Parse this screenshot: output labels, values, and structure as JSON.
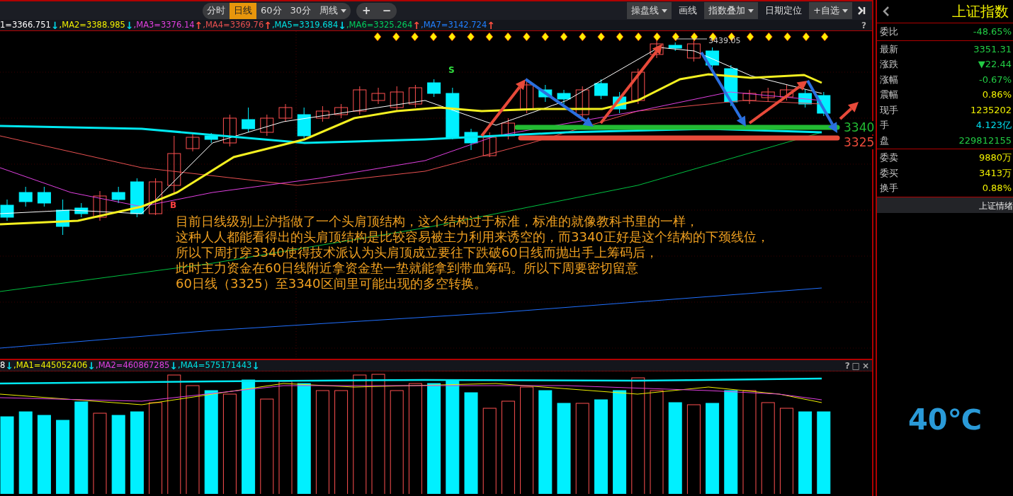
{
  "toolbar": {
    "periods": [
      {
        "label": "分时",
        "selected": false,
        "dropdown": false
      },
      {
        "label": "日线",
        "selected": true,
        "dropdown": false
      },
      {
        "label": "60分",
        "selected": false,
        "dropdown": false
      },
      {
        "label": "30分",
        "selected": false,
        "dropdown": false
      },
      {
        "label": "周线",
        "selected": false,
        "dropdown": true
      }
    ],
    "zoom_buttons": [
      "+",
      "−"
    ],
    "tools": [
      {
        "label": "操盘线",
        "dropdown": true
      },
      {
        "label": "画线",
        "dropdown": false
      },
      {
        "label": "指数叠加",
        "dropdown": true
      },
      {
        "label": "日期定位",
        "dropdown": false
      },
      {
        "label": "+自选",
        "dropdown": true
      }
    ]
  },
  "ma_legend": {
    "items": [
      {
        "kind": "value",
        "label": "1=3366.751",
        "color": "#ffffff"
      },
      {
        "kind": "arrow",
        "label": "↓",
        "color": "#00d8e8"
      },
      {
        "kind": "value",
        "label": ",MA2=3388.985",
        "color": "#f0f000"
      },
      {
        "kind": "arrow",
        "label": "↓",
        "color": "#00d8e8"
      },
      {
        "kind": "value",
        "label": ",MA3=3376.14",
        "color": "#e040e0"
      },
      {
        "kind": "arrow",
        "label": "↑",
        "color": "#ff5040"
      },
      {
        "kind": "value",
        "label": ",MA4=3369.76",
        "color": "#e85050"
      },
      {
        "kind": "arrow",
        "label": "↑",
        "color": "#ff5040"
      },
      {
        "kind": "value",
        "label": ",MA5=3319.684",
        "color": "#00e0e0"
      },
      {
        "kind": "arrow",
        "label": "↓",
        "color": "#00d8e8"
      },
      {
        "kind": "value",
        "label": ",MA6=3325.264",
        "color": "#00d060"
      },
      {
        "kind": "arrow",
        "label": "↑",
        "color": "#ff5040"
      },
      {
        "kind": "value",
        "label": ",MA7=3142.724",
        "color": "#2080ff"
      },
      {
        "kind": "arrow",
        "label": "↑",
        "color": "#ff5040"
      }
    ],
    "help": "?"
  },
  "chart": {
    "high_label": "3439.05",
    "signals": [
      {
        "label": "S",
        "kind": "sell"
      },
      {
        "label": "B",
        "kind": "buy"
      }
    ],
    "price_levels": [
      {
        "label": "3340",
        "color": "#22bb33"
      },
      {
        "label": "3325",
        "color": "#e84a3a"
      }
    ],
    "annotation_lines": [
      "目前日线级别上沪指做了一个头肩顶结构，这个结构过于标准，标准的就像教科书里的一样，",
      "这种人人都能看得出的头肩顶结构是比较容易被主力利用来诱空的，而3340正好是这个结构的下颈线位，",
      "所以下周打穿3340使得技术派认为头肩顶成立要往下跌破60日线而抛出手上筹码后，",
      "此时主力资金在60日线附近拿资金垫一垫就能拿到带血筹码。所以下周要密切留意",
      "60日线（3325）至3340区间里可能出现的多空转换。"
    ]
  },
  "volume_legend": {
    "items": [
      {
        "kind": "value",
        "label": "8",
        "color": "#ffffff"
      },
      {
        "kind": "arrow",
        "label": "↓",
        "color": "#00d8e8"
      },
      {
        "kind": "value",
        "label": ",MA1=445052406",
        "color": "#f0f000"
      },
      {
        "kind": "arrow",
        "label": "↓",
        "color": "#00d8e8"
      },
      {
        "kind": "value",
        "label": ",MA2=460867285",
        "color": "#e040e0"
      },
      {
        "kind": "arrow",
        "label": "↓",
        "color": "#00d8e8"
      },
      {
        "kind": "value",
        "label": ",MA4=575171443",
        "color": "#00e0e0"
      },
      {
        "kind": "arrow",
        "label": "↓",
        "color": "#00d8e8"
      }
    ],
    "controls": [
      "?",
      "□",
      "×"
    ]
  },
  "quote": {
    "title": "上证指数",
    "sections": [
      {
        "rows": [
          {
            "label": "委比",
            "value": "-48.65%",
            "color": "#22cc44"
          }
        ]
      },
      {
        "rows": [
          {
            "label": "最新",
            "value": "3351.31",
            "color": "#22cc44"
          },
          {
            "label": "涨跌",
            "value": "▼22.44",
            "color": "#22cc44"
          },
          {
            "label": "涨幅",
            "value": "-0.67%",
            "color": "#22cc44"
          },
          {
            "label": "震幅",
            "value": "0.86%",
            "color": "#f0f000"
          },
          {
            "label": "现手",
            "value": "1235202",
            "color": "#f0f000"
          },
          {
            "label": "手",
            "value": "4.123亿",
            "color": "#00e0f0"
          },
          {
            "label": "盘",
            "value": "229812155",
            "color": "#22cc44"
          }
        ]
      },
      {
        "rows": [
          {
            "label": "委卖",
            "value": "9880万",
            "color": "#f0f000"
          },
          {
            "label": "委买",
            "value": "3413万",
            "color": "#f0f000"
          },
          {
            "label": "换手",
            "value": "0.88%",
            "color": "#f0f000"
          }
        ]
      }
    ],
    "footer_tab": "上证情绪",
    "temperature": "40℃"
  }
}
